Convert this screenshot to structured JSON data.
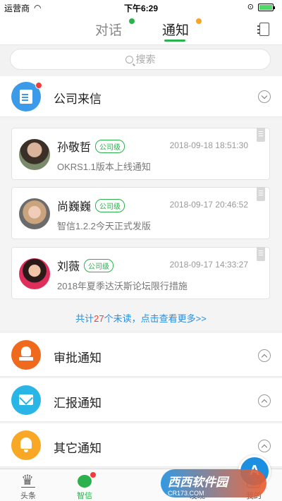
{
  "status_bar": {
    "carrier": "运营商",
    "time": "下午6:29"
  },
  "nav": {
    "tabs": [
      {
        "label": "对话",
        "active": false,
        "dot_color": "#2bb24c"
      },
      {
        "label": "通知",
        "active": true,
        "dot_color": "#f6a623"
      }
    ],
    "accent": "#2bb24c"
  },
  "search": {
    "placeholder": "搜索"
  },
  "company_letter": {
    "label": "公司来信",
    "icon": "document-icon",
    "color": "#3c9be8",
    "unread_badge": true
  },
  "cards": [
    {
      "sender": "孙敬哲",
      "level": "公司级",
      "time": "2018-09-18 18:51:30",
      "subject": "OKRS1.1版本上线通知"
    },
    {
      "sender": "尚巍巍",
      "level": "公司级",
      "time": "2018-09-17 20:46:52",
      "subject": "智信1.2.2今天正式发版"
    },
    {
      "sender": "刘薇",
      "level": "公司级",
      "time": "2018-09-17 14:33:27",
      "subject": "2018年夏季达沃斯论坛限行措施"
    }
  ],
  "more": {
    "prefix": "共计",
    "count": "27",
    "suffix": "个未读，点击查看更多>>"
  },
  "sections": [
    {
      "label": "审批通知",
      "icon": "stamp-icon",
      "color": "#f06a1d"
    },
    {
      "label": "汇报通知",
      "icon": "mail-icon",
      "color": "#29b6e6"
    },
    {
      "label": "其它通知",
      "icon": "bell-icon",
      "color": "#f9a825"
    }
  ],
  "tabbar": {
    "items": [
      {
        "label": "头条",
        "icon": "crown-icon"
      },
      {
        "label": "智信",
        "icon": "chat-icon",
        "active": true
      },
      {
        "label": "",
        "icon": "center-app-icon"
      },
      {
        "label": "发现",
        "icon": "discover-icon"
      },
      {
        "label": "我的",
        "icon": "profile-icon"
      }
    ]
  },
  "watermark": {
    "title": "西西软件园",
    "subtitle": "CR173.COM"
  }
}
